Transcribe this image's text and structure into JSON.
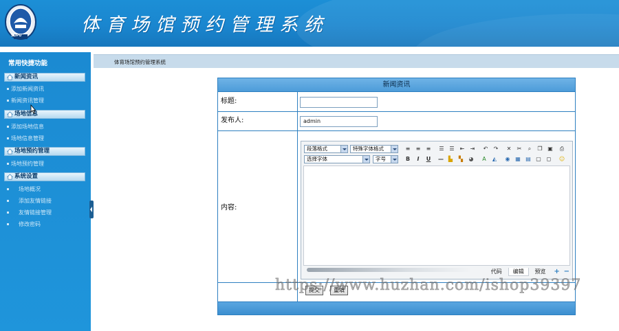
{
  "header": {
    "title": "体育场馆预约管理系统",
    "logo_text": "SDPU"
  },
  "sidebar": {
    "title": "常用快捷功能",
    "groups": [
      {
        "label": "新闻资讯",
        "items": [
          "添加新闻资讯",
          "新闻资讯管理"
        ]
      },
      {
        "label": "场地信息",
        "items": [
          "添加场地信息",
          "场地信息管理"
        ]
      },
      {
        "label": "场地预约管理",
        "items": [
          "场地预约管理"
        ]
      },
      {
        "label": "系统设置",
        "items": [
          "场地概况",
          "添加友情链接",
          "友情链接管理",
          "修改密码"
        ]
      }
    ]
  },
  "breadcrumb": "体育场馆预约管理系统",
  "form": {
    "heading": "新闻资讯",
    "title_label": "标题:",
    "title_value": "",
    "publisher_label": "发布人:",
    "publisher_value": "admin",
    "content_label": "内容:",
    "submit_label": "提交",
    "reset_label": "重填"
  },
  "editor": {
    "paragraph_format": "段落格式",
    "special_format": "特殊字体格式",
    "font_select": "选择字体",
    "font_size": "字号",
    "mode_tabs": [
      "代码",
      "编辑",
      "预览"
    ],
    "active_mode": "编辑"
  },
  "watermark": "https://www.huzhan.com/ishop39397",
  "colors": {
    "header": "#1a86cf",
    "sidebar": "#1b8ad2",
    "form_border": "#2d7fc0",
    "form_header": "#5aa6e0"
  }
}
